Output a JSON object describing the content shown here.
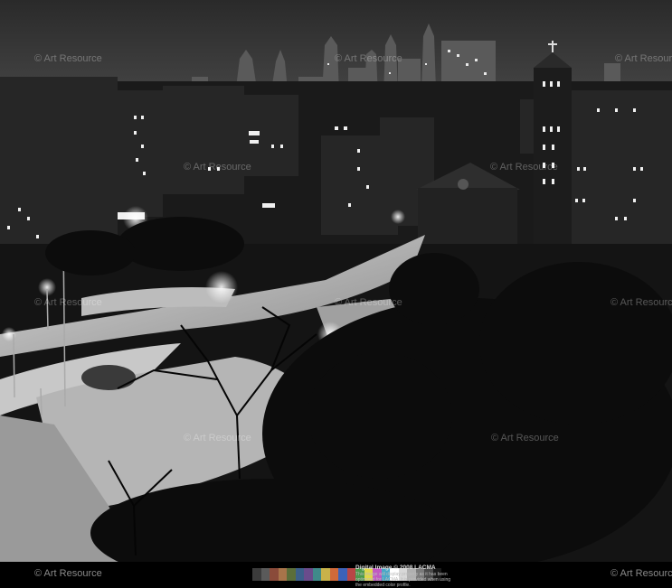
{
  "watermarks": {
    "text": "Art Resource",
    "symbol": "©"
  },
  "footer": {
    "left_watermark": "© Art Resource",
    "right_watermark": "© Art Resource",
    "credit_title": "Digital Image © 2008 LACMA",
    "credit_body": "This image will display properly as it has been optimized for LACMA. It is provided when using the embedded color profile.",
    "color_bar": [
      "#3b3b3b",
      "#5a5a5a",
      "#8a4b3a",
      "#a8744a",
      "#5b6e3a",
      "#3c5f8a",
      "#6a4c8c",
      "#3f8a8a",
      "#c8b24a",
      "#d06a3a",
      "#3d62b8",
      "#b84646",
      "#4c9a4c",
      "#e0d84a",
      "#c15ac1",
      "#4aa8c8",
      "#ffffff",
      "#d8d8d8",
      "#b0b0b0",
      "#7a7a7a",
      "#4a4a4a",
      "#1a1a1a"
    ]
  }
}
